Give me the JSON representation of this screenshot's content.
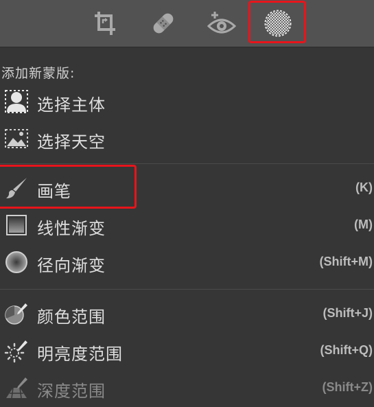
{
  "toolbar": {
    "tools": [
      {
        "icon": "crop-icon",
        "name": "crop"
      },
      {
        "icon": "healing-bandage-icon",
        "name": "healing"
      },
      {
        "icon": "red-eye-icon",
        "name": "red-eye"
      },
      {
        "icon": "masking-icon",
        "name": "masking",
        "selected": true
      }
    ],
    "highlight_color": "#e8141b"
  },
  "panel": {
    "section_title": "添加新蒙版:",
    "groups": [
      {
        "items": [
          {
            "label": "选择主体",
            "shortcut": "",
            "icon": "select-subject-icon"
          },
          {
            "label": "选择天空",
            "shortcut": "",
            "icon": "select-sky-icon"
          }
        ]
      },
      {
        "items": [
          {
            "label": "画笔",
            "shortcut": "(K)",
            "icon": "brush-icon",
            "highlighted": true
          },
          {
            "label": "线性渐变",
            "shortcut": "(M)",
            "icon": "linear-gradient-icon"
          },
          {
            "label": "径向渐变",
            "shortcut": "(Shift+M)",
            "icon": "radial-gradient-icon"
          }
        ]
      },
      {
        "items": [
          {
            "label": "颜色范围",
            "shortcut": "(Shift+J)",
            "icon": "color-range-icon"
          },
          {
            "label": "明亮度范围",
            "shortcut": "(Shift+Q)",
            "icon": "luminance-range-icon"
          },
          {
            "label": "深度范围",
            "shortcut": "(Shift+Z)",
            "icon": "depth-range-icon",
            "disabled": true
          }
        ]
      }
    ]
  },
  "colors": {
    "background": "#363636",
    "toolbar_background": "#525252",
    "text": "#dedede",
    "disabled_text": "#8a8a8a",
    "annotation": "#e8141b"
  }
}
